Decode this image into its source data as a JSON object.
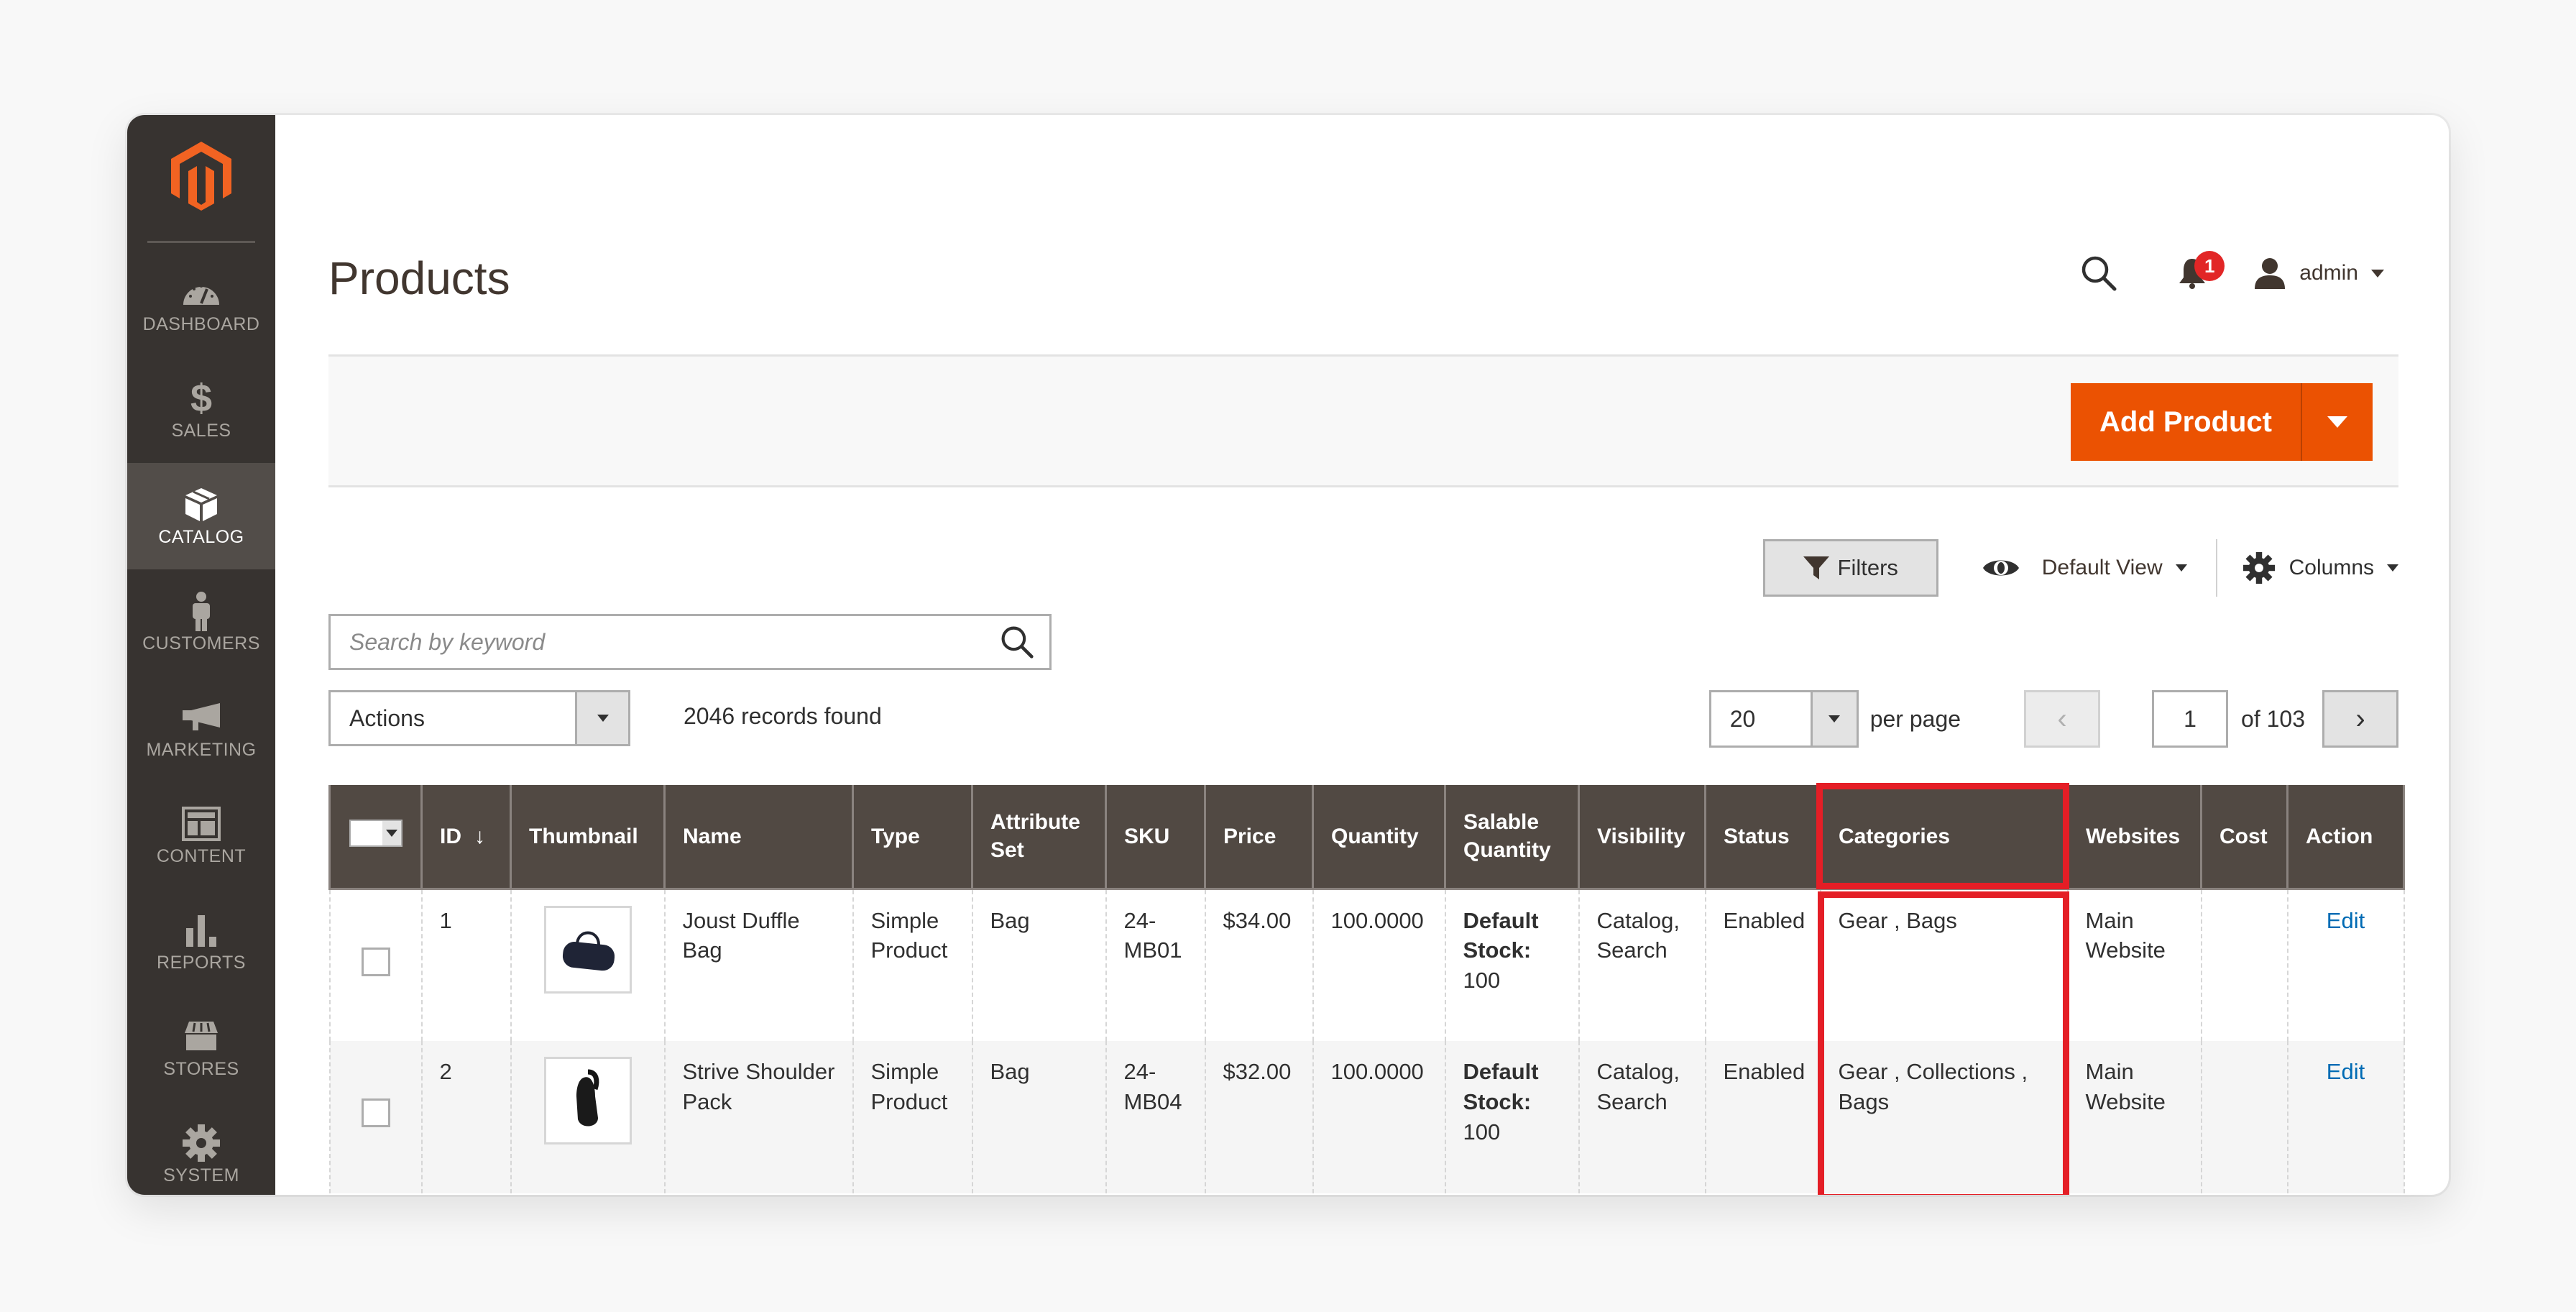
{
  "sidebar": {
    "items": [
      {
        "label": "DASHBOARD",
        "icon": "dashboard-gauge-icon"
      },
      {
        "label": "SALES",
        "icon": "dollar-icon"
      },
      {
        "label": "CATALOG",
        "icon": "box-icon",
        "active": true
      },
      {
        "label": "CUSTOMERS",
        "icon": "person-icon"
      },
      {
        "label": "MARKETING",
        "icon": "megaphone-icon"
      },
      {
        "label": "CONTENT",
        "icon": "layout-icon"
      },
      {
        "label": "REPORTS",
        "icon": "bar-chart-icon"
      },
      {
        "label": "STORES",
        "icon": "storefront-icon"
      },
      {
        "label": "SYSTEM",
        "icon": "gear-icon"
      }
    ]
  },
  "header": {
    "title": "Products",
    "notification_count": "1",
    "user_name": "admin"
  },
  "action_bar": {
    "add_product_label": "Add Product"
  },
  "toolbar": {
    "filters_label": "Filters",
    "view_label": "Default View",
    "columns_label": "Columns",
    "search_placeholder": "Search by keyword",
    "search_value": "",
    "actions_label": "Actions",
    "records_found": "2046 records found",
    "per_page_value": "20",
    "per_page_label": "per page",
    "current_page": "1",
    "total_pages_label": "of 103"
  },
  "table": {
    "columns": [
      "ID",
      "Thumbnail",
      "Name",
      "Type",
      "Attribute Set",
      "SKU",
      "Price",
      "Quantity",
      "Salable Quantity",
      "Visibility",
      "Status",
      "Categories",
      "Websites",
      "Cost",
      "Action"
    ],
    "sort_indicator": "↓",
    "rows": [
      {
        "id": "1",
        "thumbnail": "duffle-bag-thumbnail",
        "name": "Joust Duffle Bag",
        "type": "Simple Product",
        "attribute_set": "Bag",
        "sku": "24-MB01",
        "price": "$34.00",
        "quantity": "100.0000",
        "salable_label": "Default Stock:",
        "salable_value": "100",
        "visibility": "Catalog, Search",
        "status": "Enabled",
        "categories": "Gear , Bags",
        "websites": "Main Website",
        "cost": "",
        "action": "Edit"
      },
      {
        "id": "2",
        "thumbnail": "shoulder-pack-thumbnail",
        "name": "Strive Shoulder Pack",
        "type": "Simple Product",
        "attribute_set": "Bag",
        "sku": "24-MB04",
        "price": "$32.00",
        "quantity": "100.0000",
        "salable_label": "Default Stock:",
        "salable_value": "100",
        "visibility": "Catalog, Search",
        "status": "Enabled",
        "categories": "Gear , Collections , Bags",
        "websites": "Main Website",
        "cost": "",
        "action": "Edit"
      }
    ]
  },
  "colors": {
    "brand_orange": "#eb5202",
    "sidebar_bg": "#373330",
    "table_header_bg": "#514943",
    "highlight_red": "#e41e26",
    "link_blue": "#006bb4",
    "badge_red": "#e22626"
  }
}
